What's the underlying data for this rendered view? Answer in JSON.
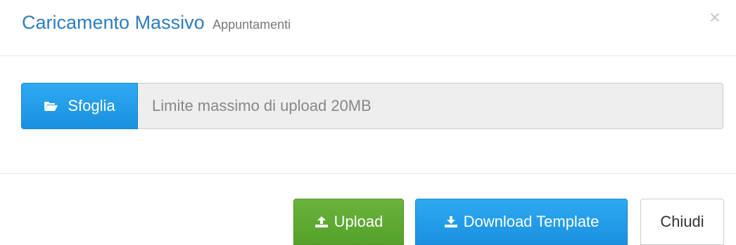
{
  "header": {
    "title": "Caricamento Massivo",
    "subtitle": "Appuntamenti",
    "close_symbol": "×"
  },
  "body": {
    "browse_label": "Sfoglia",
    "browse_icon": "folder-open-icon",
    "file_placeholder": "Limite massimo di upload 20MB"
  },
  "footer": {
    "upload_label": "Upload",
    "upload_icon": "upload-icon",
    "template_label": "Download Template",
    "template_icon": "download-icon",
    "close_label": "Chiudi"
  },
  "colors": {
    "title": "#2d7dbb",
    "primary": "#1a90e0",
    "success": "#5aa830"
  }
}
